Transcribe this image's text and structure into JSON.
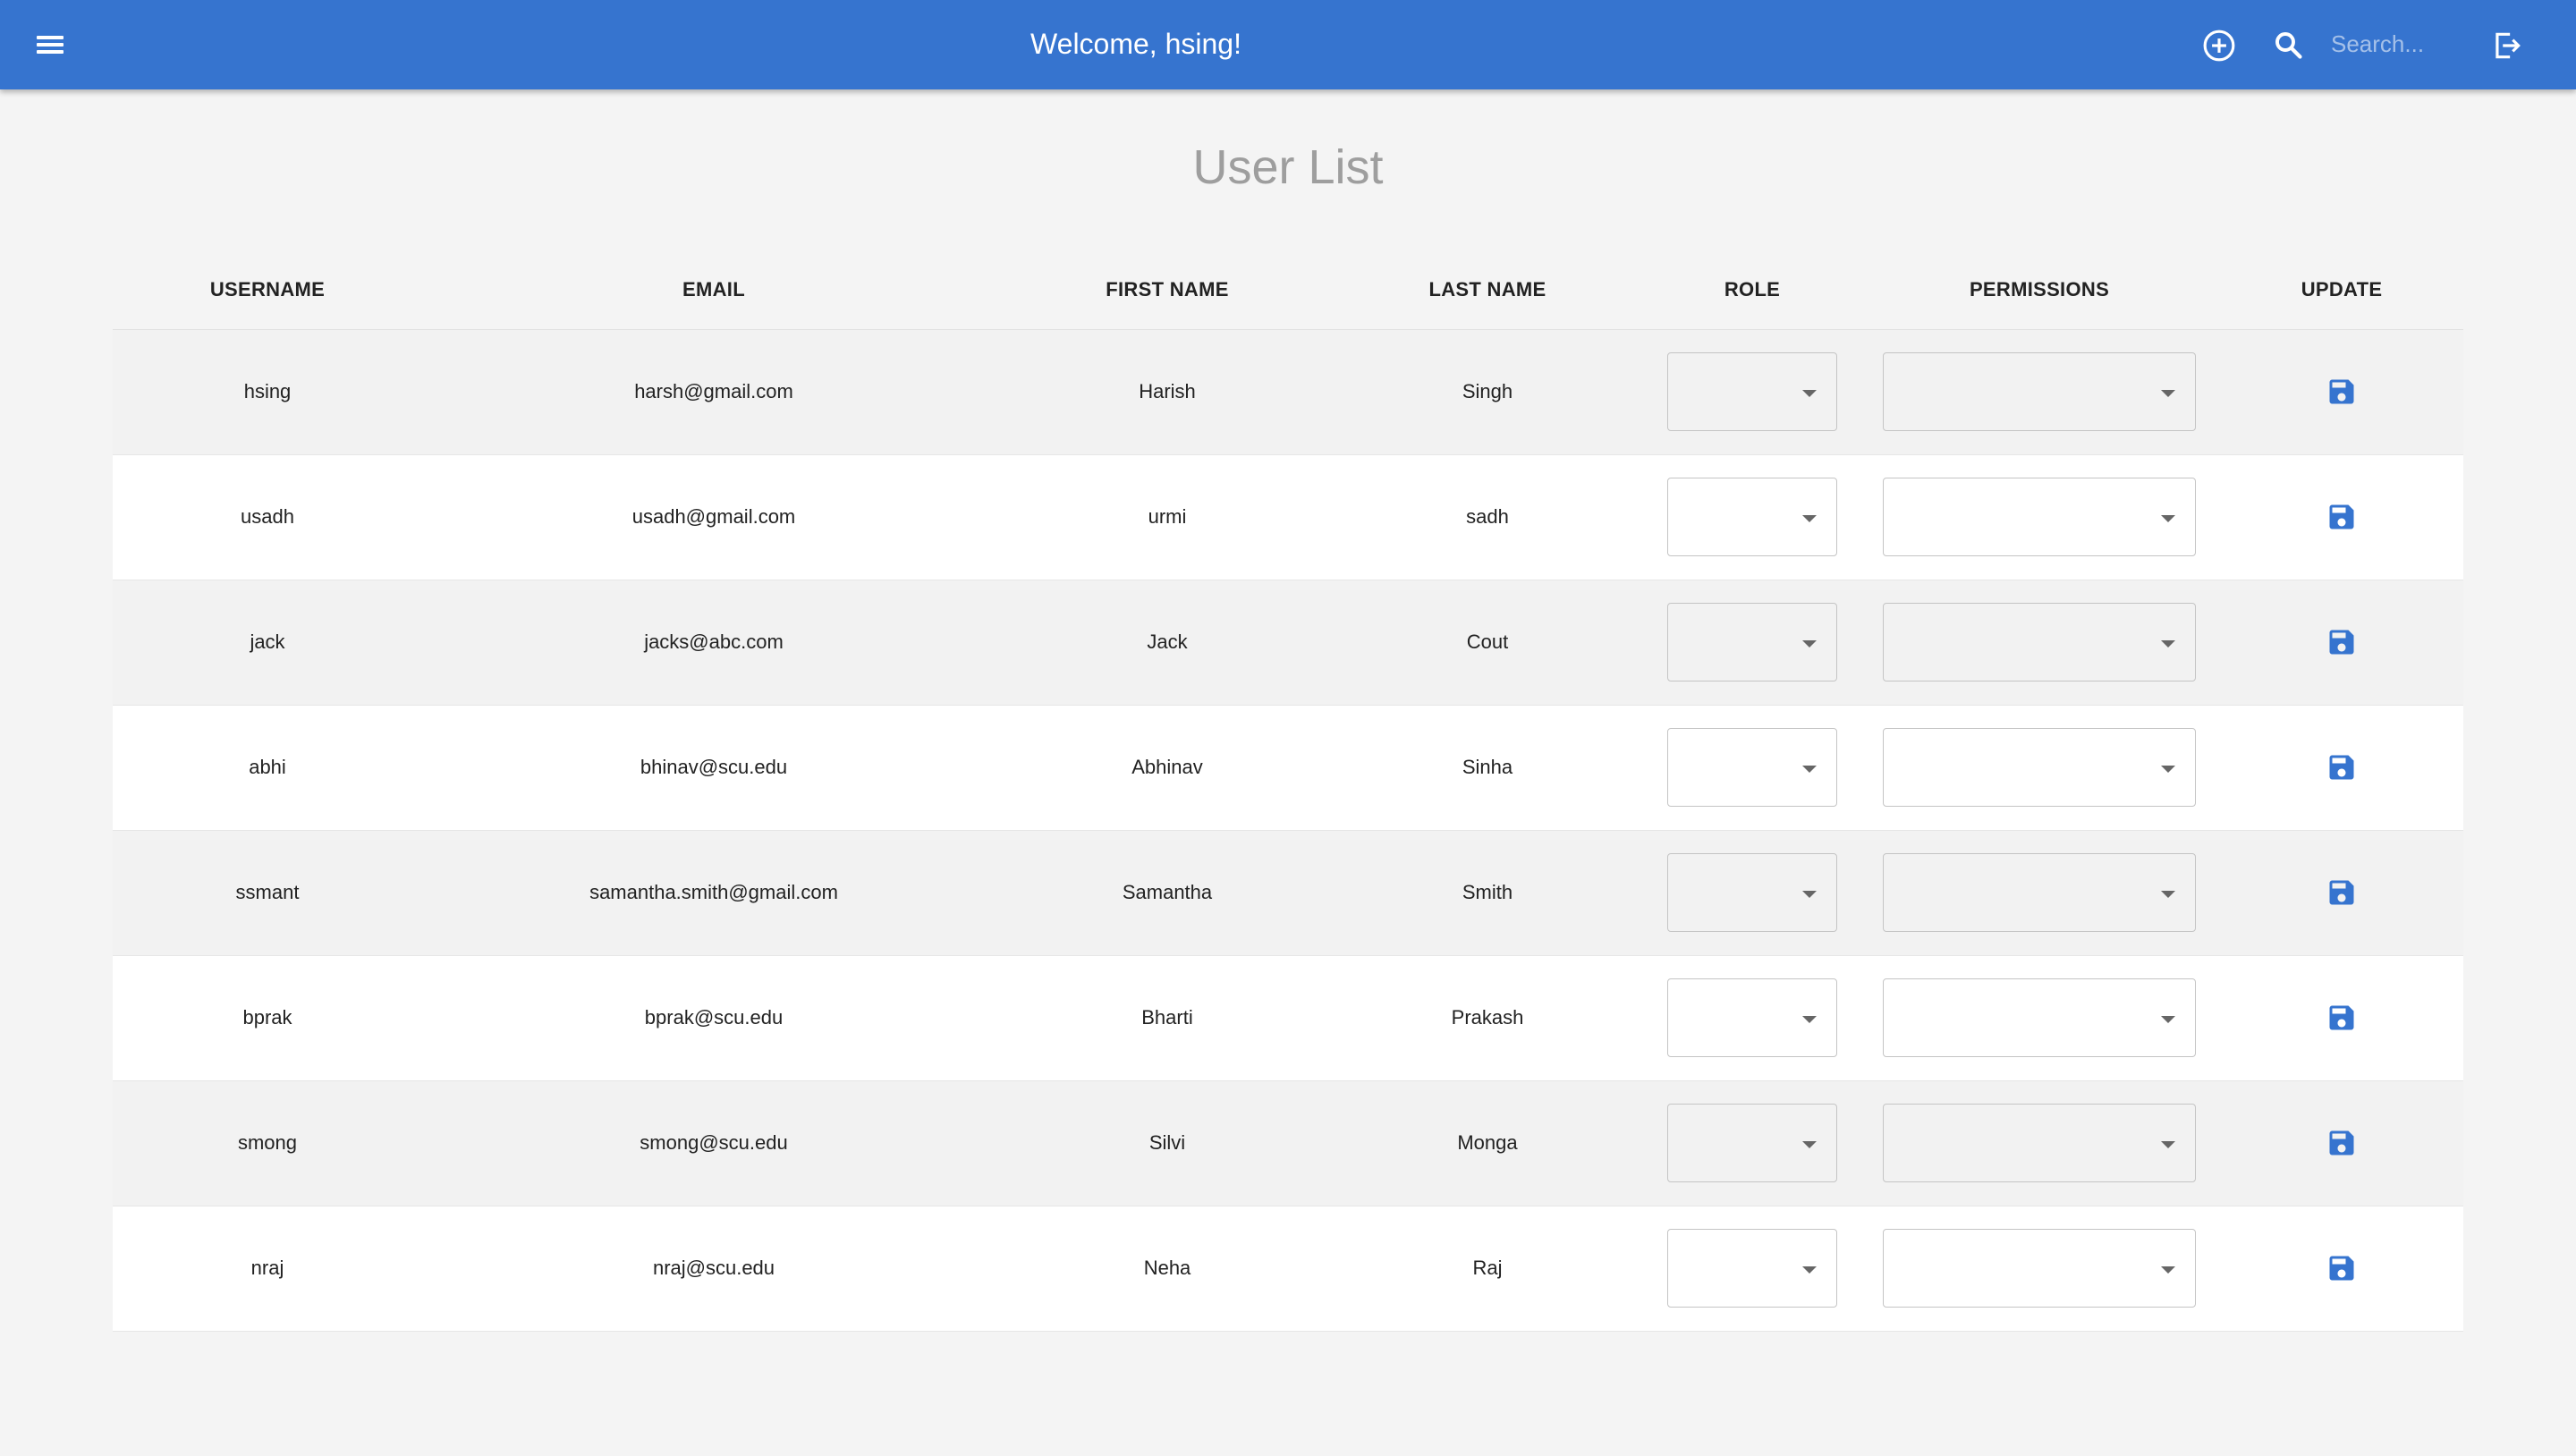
{
  "header": {
    "title": "Welcome, hsing!",
    "menu_icon": "hamburger-menu-icon",
    "add_icon": "add-circle-icon",
    "search_icon": "search-icon",
    "search_placeholder": "Search...",
    "search_value": "",
    "logout_icon": "logout-icon"
  },
  "page": {
    "title": "User List"
  },
  "table": {
    "columns": [
      "USERNAME",
      "EMAIL",
      "FIRST NAME",
      "LAST NAME",
      "ROLE",
      "PERMISSIONS",
      "UPDATE"
    ],
    "rows": [
      {
        "username": "hsing",
        "email": "harsh@gmail.com",
        "first_name": "Harish",
        "last_name": "Singh",
        "role": "",
        "permissions": ""
      },
      {
        "username": "usadh",
        "email": "usadh@gmail.com",
        "first_name": "urmi",
        "last_name": "sadh",
        "role": "",
        "permissions": ""
      },
      {
        "username": "jack",
        "email": "jacks@abc.com",
        "first_name": "Jack",
        "last_name": "Cout",
        "role": "",
        "permissions": ""
      },
      {
        "username": "abhi",
        "email": "bhinav@scu.edu",
        "first_name": "Abhinav",
        "last_name": "Sinha",
        "role": "",
        "permissions": ""
      },
      {
        "username": "ssmant",
        "email": "samantha.smith@gmail.com",
        "first_name": "Samantha",
        "last_name": "Smith",
        "role": "",
        "permissions": ""
      },
      {
        "username": "bprak",
        "email": "bprak@scu.edu",
        "first_name": "Bharti",
        "last_name": "Prakash",
        "role": "",
        "permissions": ""
      },
      {
        "username": "smong",
        "email": "smong@scu.edu",
        "first_name": "Silvi",
        "last_name": "Monga",
        "role": "",
        "permissions": ""
      },
      {
        "username": "nraj",
        "email": "nraj@scu.edu",
        "first_name": "Neha",
        "last_name": "Raj",
        "role": "",
        "permissions": ""
      }
    ],
    "update_icon": "save-icon"
  },
  "colors": {
    "appbar": "#3674cf",
    "save_icon": "#3674cf",
    "background": "#f4f4f4",
    "title_gray": "#9e9e9e"
  }
}
